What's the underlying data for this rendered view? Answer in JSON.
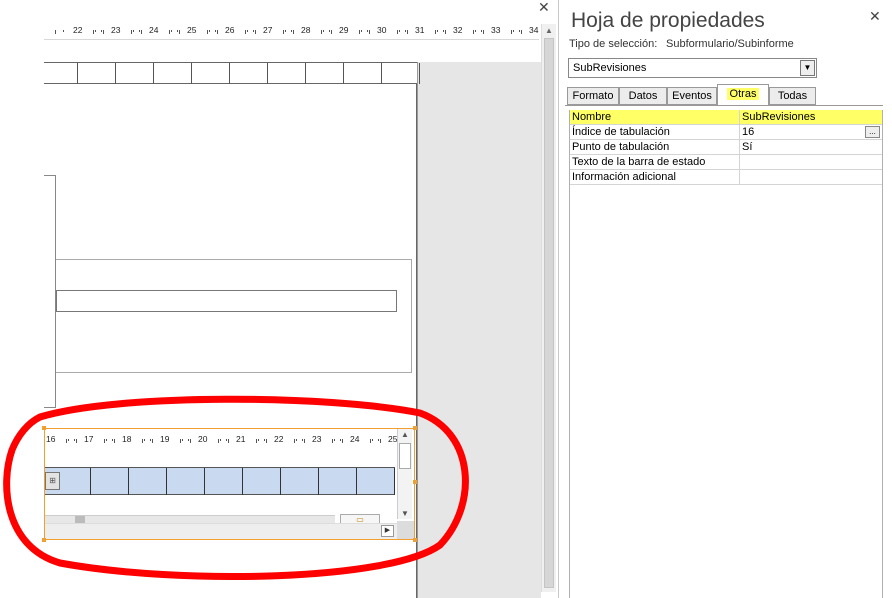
{
  "design": {
    "close_glyph": "✕",
    "top_ruler_numbers": [
      "22",
      "23",
      "24",
      "25",
      "26",
      "27",
      "28",
      "29",
      "30",
      "31",
      "32",
      "33",
      "34"
    ],
    "sub_ruler_numbers": [
      "16",
      "17",
      "18",
      "19",
      "20",
      "21",
      "22",
      "23",
      "24",
      "25"
    ],
    "nav_glyph": "▶"
  },
  "property_sheet": {
    "title": "Hoja de propiedades",
    "close_glyph": "✕",
    "selection_label": "Tipo de selección:",
    "selection_value": "Subformulario/Subinforme",
    "combo_value": "SubRevisiones",
    "combo_arrow": "▼",
    "tabs": [
      {
        "label": "Formato",
        "active": false
      },
      {
        "label": "Datos",
        "active": false
      },
      {
        "label": "Eventos",
        "active": false
      },
      {
        "label": "Otras",
        "active": true
      },
      {
        "label": "Todas",
        "active": false
      }
    ],
    "rows": [
      {
        "name": "Nombre",
        "value": "SubRevisiones",
        "highlighted": true
      },
      {
        "name": "Índice de tabulación",
        "value": "16",
        "has_ellipsis": true
      },
      {
        "name": "Punto de tabulación",
        "value": "Sí"
      },
      {
        "name": "Texto de la barra de estado",
        "value": ""
      },
      {
        "name": "Información adicional",
        "value": ""
      }
    ],
    "ellipsis": "..."
  },
  "colors": {
    "highlight": "#ffff66",
    "annotation": "#ff0000",
    "selection_border": "#f0a030",
    "datasheet_row": "#c9daf0"
  }
}
